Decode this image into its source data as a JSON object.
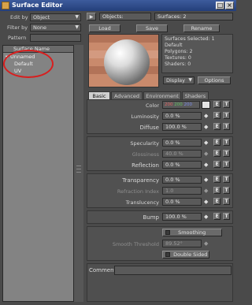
{
  "window": {
    "title": "Surface Editor"
  },
  "left": {
    "edit_by_label": "Edit by",
    "edit_by_value": "Object",
    "filter_by_label": "Filter by",
    "filter_by_value": "None",
    "pattern_label": "Pattern",
    "list_header": "Surface Name",
    "items": [
      {
        "label": "Unnamed",
        "expanded": true
      },
      {
        "label": "Default"
      },
      {
        "label": "UV"
      }
    ]
  },
  "header": {
    "objects_label": "Objects:",
    "surfaces_label": "Surfaces: 2"
  },
  "toolbar": {
    "load": "Load",
    "save": "Save",
    "rename": "Rename"
  },
  "info": {
    "lines": [
      "Surfaces Selected: 1",
      "Default",
      "Polygons: 2",
      "Textures: 0",
      "Shaders: 0"
    ],
    "display": "Display",
    "options": "Options"
  },
  "tabs": [
    "Basic",
    "Advanced",
    "Environment",
    "Shaders"
  ],
  "properties": {
    "color_label": "Color",
    "color_values": [
      "200",
      "200",
      "200"
    ],
    "luminosity_label": "Luminosity",
    "luminosity_value": "0.0 %",
    "diffuse_label": "Diffuse",
    "diffuse_value": "100.0 %",
    "specularity_label": "Specularity",
    "specularity_value": "0.0 %",
    "glossiness_label": "Glossiness",
    "glossiness_value": "40.0 %",
    "reflection_label": "Reflection",
    "reflection_value": "0.0 %",
    "transparency_label": "Transparency",
    "transparency_value": "0.0 %",
    "refraction_label": "Refraction Index",
    "refraction_value": "1.0",
    "translucency_label": "Translucency",
    "translucency_value": "0.0 %",
    "bump_label": "Bump",
    "bump_value": "100.0 %",
    "smoothing_label": "Smoothing",
    "smooth_threshold_label": "Smooth Threshold",
    "smooth_threshold_value": "89.52°",
    "double_sided_label": "Double Sided",
    "comment_label": "Comment",
    "e": "E",
    "t": "T"
  }
}
